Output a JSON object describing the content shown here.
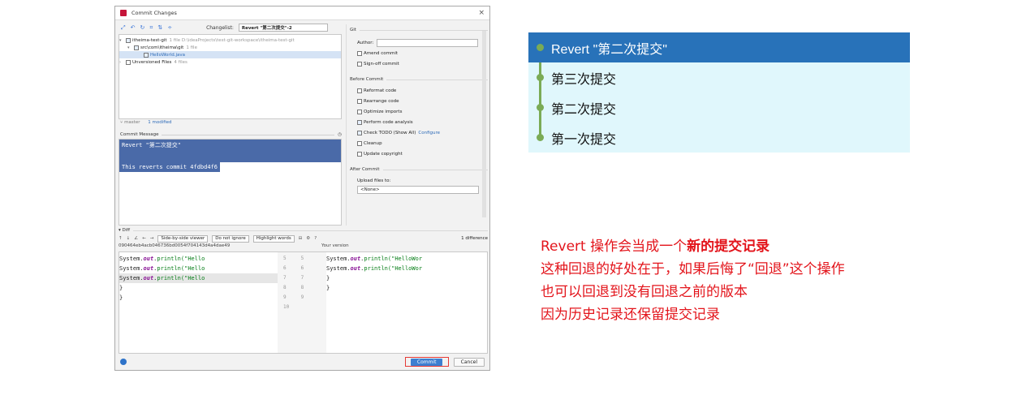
{
  "dialog": {
    "title": "Commit Changes",
    "changelist_label": "Changelist:",
    "changelist_value": "Revert \"第二次提交\"-2",
    "tree": [
      {
        "name": "itheima-test-git",
        "meta": "1 file  D:\\ideaProjects\\test-git-workspace\\itheima-test-git"
      },
      {
        "name": "src\\com\\itheima\\git",
        "meta": "1 file"
      },
      {
        "name": "HelloWorld.java",
        "meta": ""
      },
      {
        "name": "Unversioned Files",
        "meta": "4 files"
      }
    ],
    "branch": "master",
    "modified": "1 modified",
    "commit_message_label": "Commit Message",
    "commit_message_line1": "Revert \"第二次提交\"",
    "commit_message_line2": "This reverts commit 4fdbd4f6",
    "git_label": "Git",
    "author_label": "Author:",
    "amend": "Amend commit",
    "signoff": "Sign-off commit",
    "before_commit_label": "Before Commit",
    "before_options": [
      "Reformat code",
      "Rearrange code",
      "Optimize imports",
      "Perform code analysis",
      "Check TODO (Show All)",
      "Cleanup",
      "Update copyright"
    ],
    "configure": "Configure",
    "after_commit_label": "After Commit",
    "upload_label": "Upload files to:",
    "upload_value": "<None>",
    "diff_label": "Diff",
    "viewer": "Side-by-side viewer",
    "ignore": "Do not ignore",
    "highlight": "Highlight words",
    "difference_count": "1 difference",
    "left_hash": "090464eb4acb046736bd0054f704143d4a4dae49",
    "right_title": "Your version",
    "code_left": [
      "        System.",
      "        System.",
      "        System."
    ],
    "code_suffix": "println(\"Hello",
    "code_out": "out",
    "code_right_suffix": "println(\"HelloWor",
    "brace1": "    }",
    "brace2": "}",
    "gutter_left": [
      "5",
      "6",
      "7",
      "8",
      "9",
      "10"
    ],
    "gutter_right": [
      "5",
      "6",
      "7",
      "8",
      "9"
    ],
    "commit_button": "Commit",
    "cancel_button": "Cancel"
  },
  "history": [
    {
      "label": "Revert \"第二次提交\"",
      "selected": true
    },
    {
      "label": "第三次提交",
      "selected": false
    },
    {
      "label": "第二次提交",
      "selected": false
    },
    {
      "label": "第一次提交",
      "selected": false
    }
  ],
  "notes": {
    "line1_prefix": "Revert 操作会当成一个",
    "line1_bold": "新的提交记录",
    "line2": "这种回退的好处在于，如果后悔了“回退”这个操作",
    "line3": "也可以回退到没有回退之前的版本",
    "line4": "因为历史记录还保留提交记录"
  },
  "colors": {
    "accent": "#2872b9",
    "notes": "#e3141b",
    "graph": "#7aab55"
  }
}
